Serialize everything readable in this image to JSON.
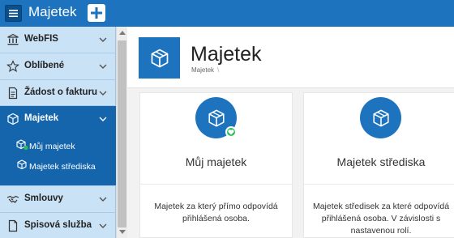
{
  "header": {
    "title": "Majetek",
    "menu_icon": "hamburger-icon",
    "add_icon": "plus-icon",
    "accent_color": "#1e73be"
  },
  "sidebar": {
    "items": [
      {
        "label": "WebFIS",
        "icon": "bank-icon"
      },
      {
        "label": "Oblíbené",
        "icon": "star-icon"
      },
      {
        "label": "Žádost o fakturu",
        "icon": "document-icon"
      },
      {
        "label": "Majetek",
        "icon": "box-icon",
        "active": true
      },
      {
        "label": "Smlouvy",
        "icon": "handshake-icon"
      },
      {
        "label": "Spisová služba",
        "icon": "file-icon"
      }
    ],
    "subitems": [
      {
        "label": "Můj majetek",
        "icon": "box-user-icon"
      },
      {
        "label": "Majetek střediska",
        "icon": "boxes-icon"
      }
    ],
    "active_color": "#1565ad",
    "background_color": "#c9e2f6"
  },
  "main": {
    "page_title": "Majetek",
    "breadcrumb": "Majetek",
    "breadcrumb_separator": "\\",
    "cards": [
      {
        "title": "Můj majetek",
        "description": "Majetek za který přímo odpovídá přihlášená osoba.",
        "icon": "box-icon",
        "badge_icon": "heart-icon",
        "badge_color": "#2ebd59"
      },
      {
        "title": "Majetek střediska",
        "description": "Majetek středisek za které odpovídá přihlášená osoba. V závislosti s nastavenou rolí.",
        "icon": "box-icon"
      }
    ]
  }
}
